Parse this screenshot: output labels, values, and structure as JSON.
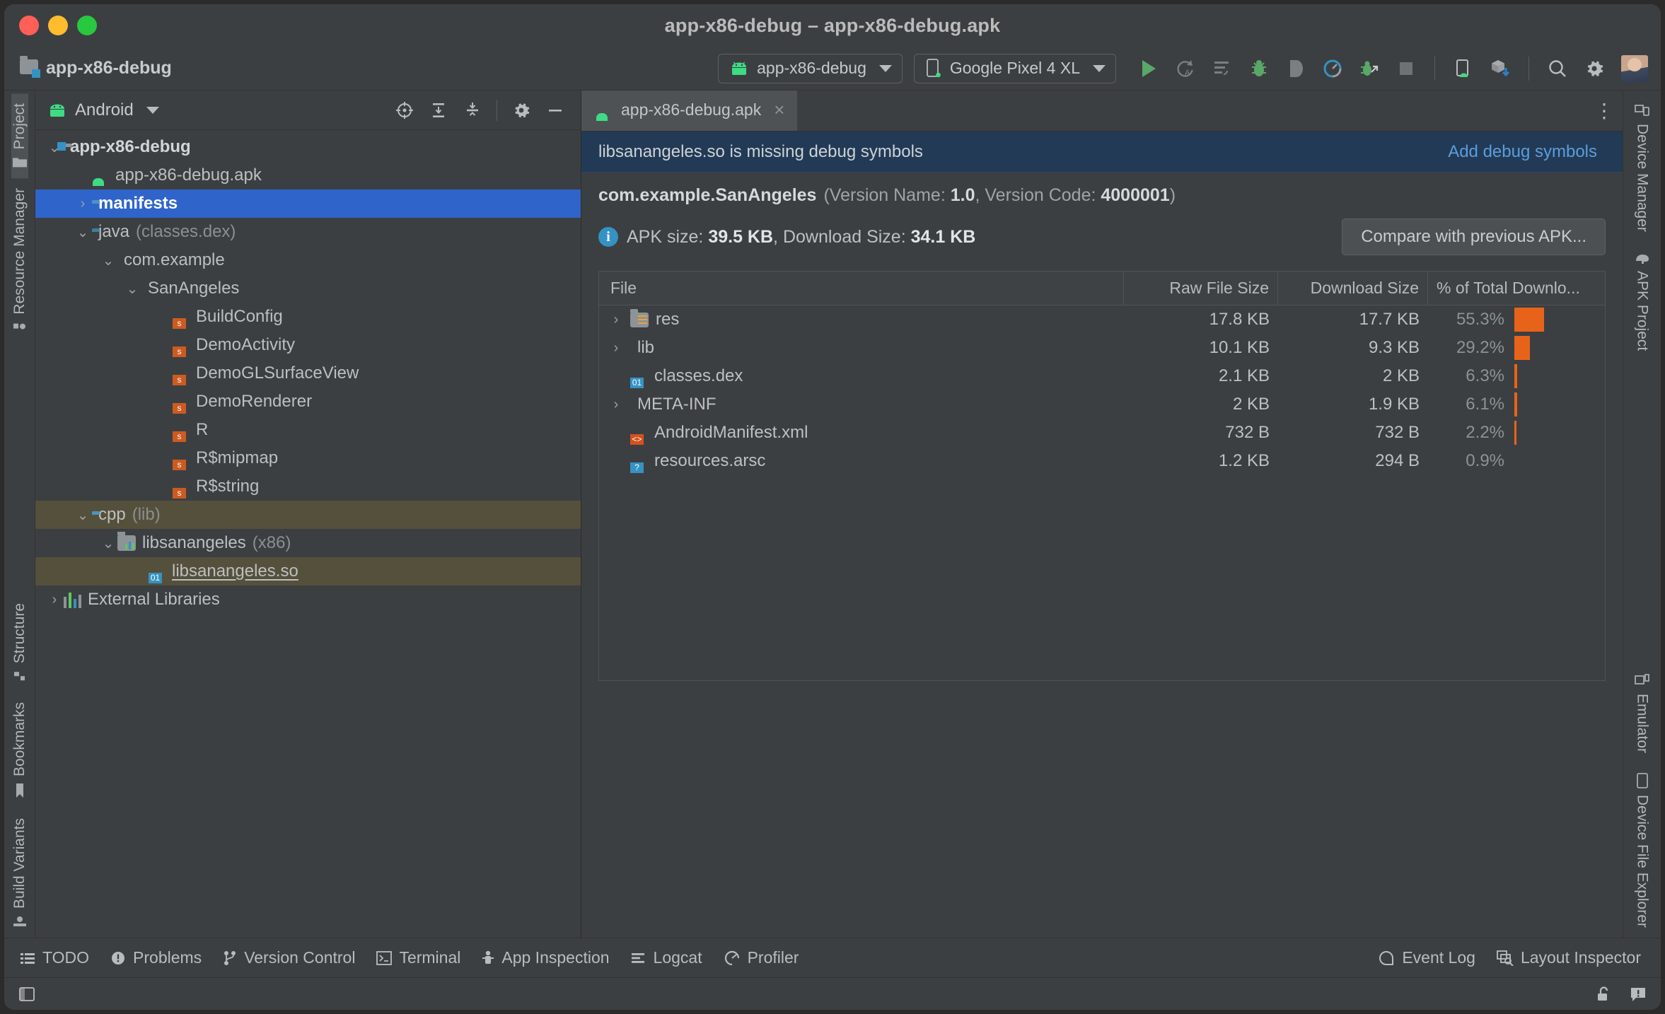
{
  "window": {
    "title": "app-x86-debug – app-x86-debug.apk",
    "traffic": {
      "close": "close-button",
      "minimize": "minimize-button",
      "zoom": "zoom-button"
    }
  },
  "navbar": {
    "breadcrumb": "app-x86-debug",
    "run_config": "app-x86-debug",
    "device": "Google Pixel 4 XL",
    "icons": [
      {
        "name": "run-icon",
        "title": "Run"
      },
      {
        "name": "rerun-icon",
        "title": "Apply Changes and Restart Activity"
      },
      {
        "name": "apply-code-changes-icon",
        "title": "Apply Code Changes"
      },
      {
        "name": "debug-icon",
        "title": "Debug"
      },
      {
        "name": "attach-debugger-icon",
        "title": "Attach Debugger to Android Process"
      },
      {
        "name": "profiler-icon",
        "title": "Profile"
      },
      {
        "name": "run-native-debug-icon",
        "title": "Run with native debug"
      },
      {
        "name": "stop-icon",
        "title": "Stop"
      },
      {
        "name": "device-manager-icon",
        "title": "Device Manager"
      },
      {
        "name": "sdk-download-icon",
        "title": "SDK Manager"
      },
      {
        "name": "search-icon",
        "title": "Search Everywhere"
      },
      {
        "name": "settings-gear-icon",
        "title": "Settings"
      },
      {
        "name": "user-avatar",
        "title": "Account"
      }
    ]
  },
  "left_rail": {
    "items": [
      {
        "label": "Project",
        "icon": "project-folder-icon",
        "active": true
      },
      {
        "label": "Resource Manager",
        "icon": "resource-manager-icon",
        "active": false
      },
      {
        "label": "Structure",
        "icon": "structure-icon",
        "active": false
      },
      {
        "label": "Bookmarks",
        "icon": "bookmark-icon",
        "active": false
      },
      {
        "label": "Build Variants",
        "icon": "build-variants-icon",
        "active": false
      }
    ]
  },
  "right_rail": {
    "items": [
      {
        "label": "Device Manager",
        "icon": "device-manager-icon"
      },
      {
        "label": "APK Project",
        "icon": "apk-project-icon"
      },
      {
        "label": "Emulator",
        "icon": "emulator-icon"
      },
      {
        "label": "Device File Explorer",
        "icon": "device-file-explorer-icon"
      }
    ]
  },
  "project_panel": {
    "view_selector": "Android",
    "tools": [
      {
        "name": "select-opened-file-icon"
      },
      {
        "name": "expand-all-icon"
      },
      {
        "name": "collapse-all-icon"
      },
      {
        "name": "settings-gear-icon"
      },
      {
        "name": "hide-panel-icon"
      }
    ],
    "tree": [
      {
        "label": "app-x86-debug",
        "suffix": "",
        "indent": 0,
        "arrow": "down",
        "icon": "module-folder-icon",
        "state": "bold"
      },
      {
        "label": "app-x86-debug.apk",
        "suffix": "",
        "indent": 1,
        "arrow": "none",
        "icon": "apk-file-icon",
        "state": "normal"
      },
      {
        "label": "manifests",
        "suffix": "",
        "indent": 1,
        "arrow": "right",
        "icon": "folder-blue-icon",
        "state": "selected"
      },
      {
        "label": "java",
        "suffix": "(classes.dex)",
        "indent": 1,
        "arrow": "down",
        "icon": "folder-teal-icon",
        "state": "normal"
      },
      {
        "label": "com.example",
        "suffix": "",
        "indent": 2,
        "arrow": "down",
        "icon": "package-icon",
        "state": "normal"
      },
      {
        "label": "SanAngeles",
        "suffix": "",
        "indent": 3,
        "arrow": "down",
        "icon": "package-icon",
        "state": "normal"
      },
      {
        "label": "BuildConfig",
        "suffix": "",
        "indent": 4,
        "arrow": "none",
        "icon": "smali-class-icon",
        "state": "normal"
      },
      {
        "label": "DemoActivity",
        "suffix": "",
        "indent": 4,
        "arrow": "none",
        "icon": "smali-class-icon",
        "state": "normal"
      },
      {
        "label": "DemoGLSurfaceView",
        "suffix": "",
        "indent": 4,
        "arrow": "none",
        "icon": "smali-class-icon",
        "state": "normal"
      },
      {
        "label": "DemoRenderer",
        "suffix": "",
        "indent": 4,
        "arrow": "none",
        "icon": "smali-class-icon",
        "state": "normal"
      },
      {
        "label": "R",
        "suffix": "",
        "indent": 4,
        "arrow": "none",
        "icon": "smali-class-icon",
        "state": "normal"
      },
      {
        "label": "R$mipmap",
        "suffix": "",
        "indent": 4,
        "arrow": "none",
        "icon": "smali-class-icon",
        "state": "normal"
      },
      {
        "label": "R$string",
        "suffix": "",
        "indent": 4,
        "arrow": "none",
        "icon": "smali-class-icon",
        "state": "normal"
      },
      {
        "label": "cpp",
        "suffix": "(lib)",
        "indent": 1,
        "arrow": "down",
        "icon": "folder-blue-icon",
        "state": "highlight"
      },
      {
        "label": "libsanangeles",
        "suffix": "(x86)",
        "indent": 2,
        "arrow": "down",
        "icon": "native-lib-icon",
        "state": "normal"
      },
      {
        "label": "libsanangeles.so",
        "suffix": "",
        "indent": 3,
        "arrow": "none",
        "icon": "binary-file-icon",
        "state": "highlight-underline"
      },
      {
        "label": "External Libraries",
        "suffix": "",
        "indent": 0,
        "arrow": "right",
        "icon": "external-libraries-icon",
        "state": "normal"
      }
    ]
  },
  "editor": {
    "tab": {
      "label": "app-x86-debug.apk",
      "icon": "apk-file-icon",
      "close": "×"
    },
    "more_actions": "⋮",
    "banner": {
      "message": "libsanangeles.so is missing debug symbols",
      "action": "Add debug symbols"
    },
    "apk_info": {
      "package": "com.example.SanAngeles",
      "version_name_label": "(Version Name:",
      "version_name": "1.0",
      "version_code_label": ", Version Code:",
      "version_code": "4000001",
      "paren_close": ")",
      "size_prefix": "APK size:",
      "apk_size": "39.5 KB",
      "download_prefix": ", Download Size:",
      "download_size": "34.1 KB",
      "compare_button": "Compare with previous APK..."
    },
    "table": {
      "columns": [
        "File",
        "Raw File Size",
        "Download Size",
        "% of Total Downlo..."
      ],
      "rows": [
        {
          "name": "res",
          "arrow": "right",
          "icon": "res-folder-icon",
          "raw": "17.8 KB",
          "download": "17.7 KB",
          "percent": "55.3%",
          "percent_value": 55.3
        },
        {
          "name": "lib",
          "arrow": "right",
          "icon": "package-folder-icon",
          "raw": "10.1 KB",
          "download": "9.3 KB",
          "percent": "29.2%",
          "percent_value": 29.2
        },
        {
          "name": "classes.dex",
          "arrow": "none",
          "icon": "dex-file-icon",
          "raw": "2.1 KB",
          "download": "2 KB",
          "percent": "6.3%",
          "percent_value": 6.3
        },
        {
          "name": "META-INF",
          "arrow": "right",
          "icon": "package-folder-icon",
          "raw": "2 KB",
          "download": "1.9 KB",
          "percent": "6.1%",
          "percent_value": 6.1
        },
        {
          "name": "AndroidManifest.xml",
          "arrow": "none",
          "icon": "xml-file-icon",
          "raw": "732 B",
          "download": "732 B",
          "percent": "2.2%",
          "percent_value": 2.2
        },
        {
          "name": "resources.arsc",
          "arrow": "none",
          "icon": "arsc-file-icon",
          "raw": "1.2 KB",
          "download": "294 B",
          "percent": "0.9%",
          "percent_value": 0.9
        }
      ]
    }
  },
  "statusbar": {
    "left": [
      {
        "label": "TODO",
        "icon": "todo-icon"
      },
      {
        "label": "Problems",
        "icon": "problems-icon"
      },
      {
        "label": "Version Control",
        "icon": "version-control-icon"
      },
      {
        "label": "Terminal",
        "icon": "terminal-icon"
      },
      {
        "label": "App Inspection",
        "icon": "app-inspection-icon"
      },
      {
        "label": "Logcat",
        "icon": "logcat-icon"
      },
      {
        "label": "Profiler",
        "icon": "profiler-icon"
      }
    ],
    "right": [
      {
        "label": "Event Log",
        "icon": "event-log-icon"
      },
      {
        "label": "Layout Inspector",
        "icon": "layout-inspector-icon"
      }
    ]
  },
  "footer": {
    "left_icon": "toggle-tool-window-icon",
    "right_icons": [
      {
        "name": "unlocked-padlock-icon"
      },
      {
        "name": "notification-icon"
      }
    ]
  },
  "colors": {
    "accent_blue": "#2f65ca",
    "banner_bg": "#223a55",
    "link_blue": "#5b9dde",
    "bar_orange": "#e8631a",
    "highlight_olive": "#55503c",
    "panel_bg": "#3c3f41"
  }
}
